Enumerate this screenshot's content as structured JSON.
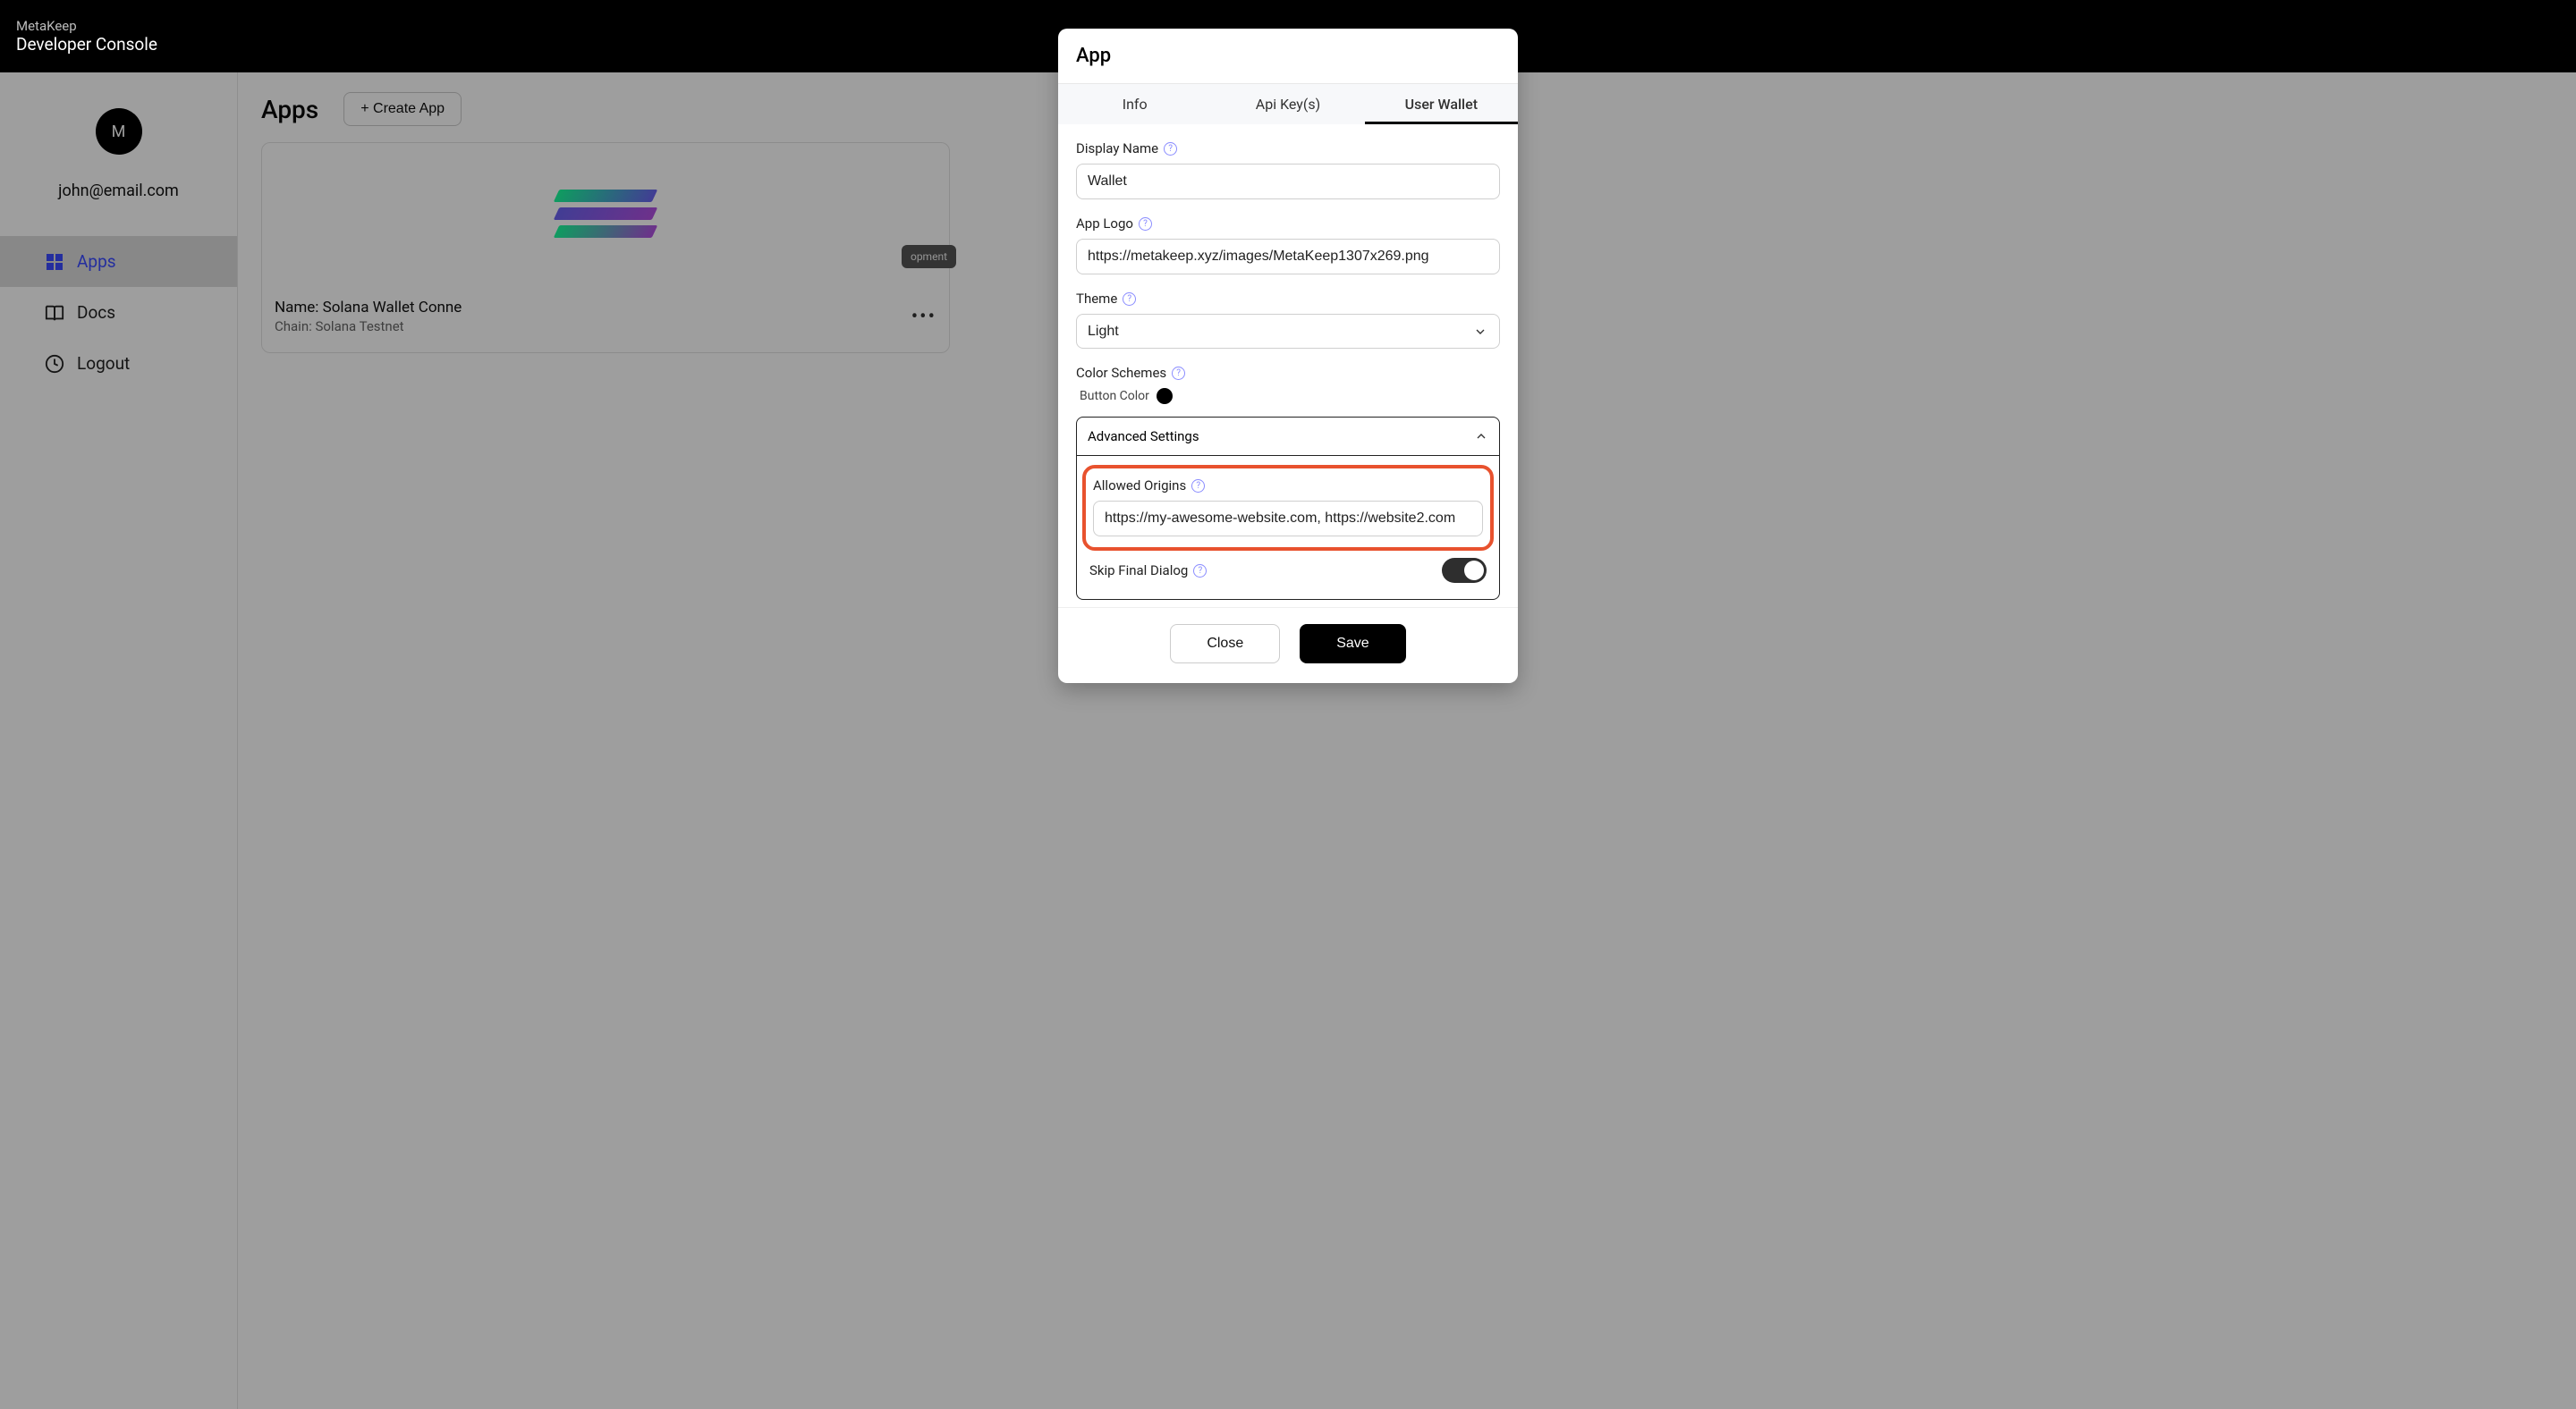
{
  "brand": {
    "sub": "MetaKeep",
    "main": "Developer Console"
  },
  "user": {
    "avatar_initial": "M",
    "email": "john@email.com"
  },
  "sidebar": {
    "items": [
      {
        "label": "Apps"
      },
      {
        "label": "Docs"
      },
      {
        "label": "Logout"
      }
    ]
  },
  "main": {
    "title": "Apps",
    "create_label": "+ Create App",
    "card": {
      "badge": "opment",
      "name_label": "Name: Solana Wallet Conne",
      "chain_label": "Chain: Solana Testnet"
    }
  },
  "modal": {
    "title": "App",
    "tabs": {
      "info": "Info",
      "keys": "Api Key(s)",
      "wallet": "User Wallet"
    },
    "display_name": {
      "label": "Display Name",
      "value": "Wallet"
    },
    "app_logo": {
      "label": "App Logo",
      "value": "https://metakeep.xyz/images/MetaKeep1307x269.png"
    },
    "theme": {
      "label": "Theme",
      "value": "Light"
    },
    "color_schemes": {
      "label": "Color Schemes",
      "button_color_label": "Button Color",
      "button_color": "#000000"
    },
    "advanced": {
      "label": "Advanced Settings",
      "allowed_origins": {
        "label": "Allowed Origins",
        "value": "https://my-awesome-website.com, https://website2.com"
      },
      "skip_final": {
        "label": "Skip Final Dialog",
        "value": true
      }
    },
    "footer": {
      "close": "Close",
      "save": "Save"
    }
  }
}
